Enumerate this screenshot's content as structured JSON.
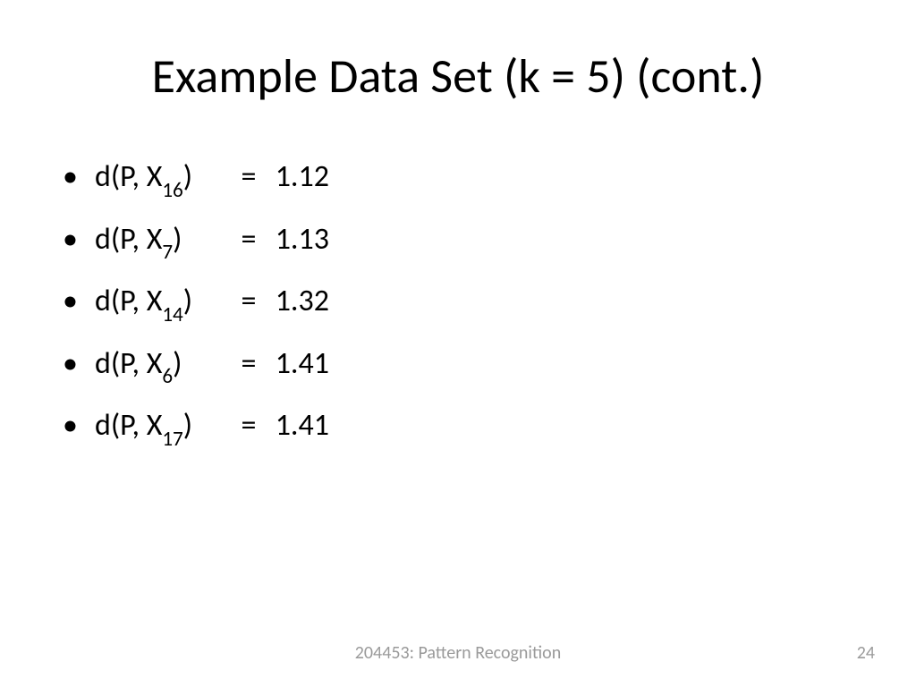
{
  "title": "Example Data Set (k = 5) (cont.)",
  "items": [
    {
      "prefix": "d(P, X",
      "sub": "16",
      "suffix": ")",
      "value": "1.12"
    },
    {
      "prefix": "d(P, X",
      "sub": "7",
      "suffix": ")",
      "value": "1.13"
    },
    {
      "prefix": "d(P, X",
      "sub": "14",
      "suffix": ")",
      "value": "1.32"
    },
    {
      "prefix": "d(P, X",
      "sub": "6",
      "suffix": ")",
      "value": "1.41"
    },
    {
      "prefix": "d(P, X",
      "sub": "17",
      "suffix": ")",
      "value": "1.41"
    }
  ],
  "eq": "=",
  "footer": "204453: Pattern Recognition",
  "page": "24"
}
